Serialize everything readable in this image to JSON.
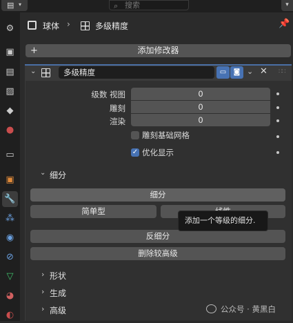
{
  "search": {
    "placeholder": "搜索"
  },
  "breadcrumb": {
    "object": "球体",
    "modifier": "多级精度"
  },
  "add_modifier": {
    "label": "添加修改器"
  },
  "modifier": {
    "name": "多级精度",
    "props": {
      "levels_viewport_label": "级数 视图",
      "levels_viewport_value": "0",
      "sculpt_label": "雕刻",
      "sculpt_value": "0",
      "render_label": "渲染",
      "render_value": "0",
      "sculpt_base_mesh_label": "雕刻基础网格",
      "sculpt_base_mesh_checked": false,
      "optimal_display_label": "优化显示",
      "optimal_display_checked": true
    },
    "subdivide_section": {
      "title": "细分",
      "subdivide_label": "细分",
      "simple_label": "简单型",
      "linear_label": "线性",
      "unsubdivide_label": "反细分",
      "delete_higher_label": "删除较高级"
    },
    "tooltip": "添加一个等级的细分.",
    "subpanels": [
      "形状",
      "生成",
      "高级"
    ]
  },
  "watermark": "公众号 · 黄黑白",
  "colors": {
    "accent": "#4772b3",
    "panel": "#303030",
    "field": "#545454"
  }
}
